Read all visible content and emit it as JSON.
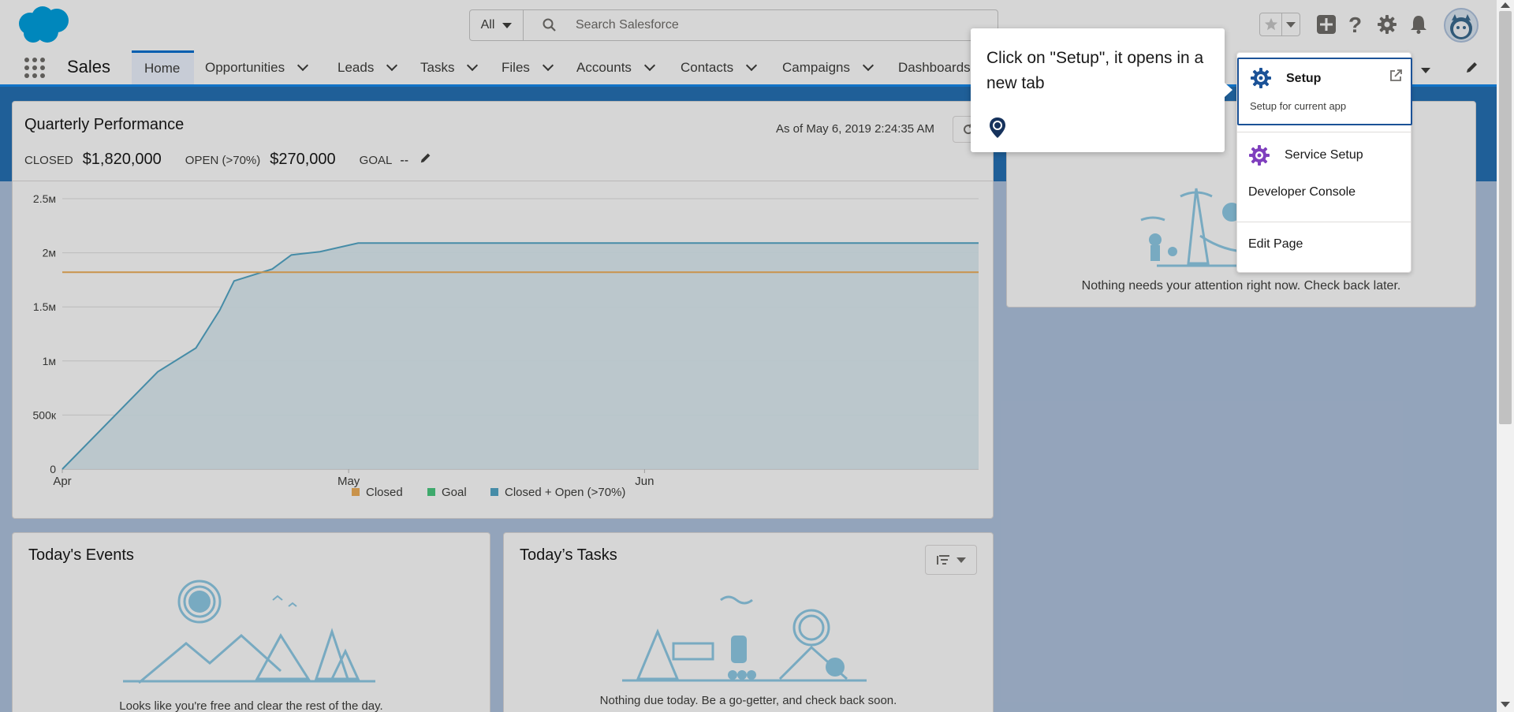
{
  "header": {
    "search_scope": "All",
    "search_placeholder": "Search Salesforce"
  },
  "nav": {
    "app_name": "Sales",
    "items": [
      {
        "label": "Home"
      },
      {
        "label": "Opportunities"
      },
      {
        "label": "Leads"
      },
      {
        "label": "Tasks"
      },
      {
        "label": "Files"
      },
      {
        "label": "Accounts"
      },
      {
        "label": "Contacts"
      },
      {
        "label": "Campaigns"
      },
      {
        "label": "Dashboards"
      }
    ]
  },
  "performance": {
    "title": "Quarterly Performance",
    "as_of": "As of May 6, 2019 2:24:35 AM",
    "closed_label": "CLOSED",
    "closed_value": "$1,820,000",
    "open_label": "OPEN (>70%)",
    "open_value": "$270,000",
    "goal_label": "GOAL",
    "goal_value": "--"
  },
  "chart_data": {
    "type": "line",
    "y_ticks": [
      "2.5м",
      "2м",
      "1.5м",
      "1м",
      "500к",
      "0"
    ],
    "x_ticks": [
      "Apr",
      "May",
      "Jun"
    ],
    "ylim": [
      0,
      2500000
    ],
    "grid": true,
    "legend_position": "bottom",
    "legend": [
      {
        "name": "Closed",
        "color": "#f0b05a"
      },
      {
        "name": "Goal",
        "color": "#4bca81"
      },
      {
        "name": "Closed + Open (>70%)",
        "color": "#54a7c7"
      }
    ],
    "series": [
      {
        "name": "Closed + Open (>70%)",
        "color": "#54a7c7",
        "x": [
          0,
          10,
          14,
          16.5,
          18,
          22,
          24,
          27,
          31,
          96
        ],
        "values": [
          0,
          900000,
          1120000,
          1470000,
          1740000,
          1850000,
          1980000,
          2010000,
          2090000,
          2090000
        ]
      },
      {
        "name": "Goal",
        "color": "#f0b05a",
        "x": [
          0,
          96
        ],
        "values": [
          1820000,
          1820000
        ]
      }
    ]
  },
  "events": {
    "title": "Today's Events",
    "empty_text": "Looks like you're free and clear the rest of the day."
  },
  "tasks": {
    "title": "Today’s Tasks",
    "empty_text": "Nothing due today. Be a go-getter, and check back soon."
  },
  "assistant": {
    "empty_text": "Nothing needs your attention right now. Check back later."
  },
  "tooltip": {
    "text": "Click on \"Setup\", it opens in a new tab"
  },
  "setup_menu": {
    "setup_label": "Setup",
    "setup_sub": "Setup for current app",
    "service_setup_label": "Service Setup",
    "developer_console_label": "Developer Console",
    "edit_page_label": "Edit Page"
  },
  "colors": {
    "brand_blue": "#00a1e0",
    "nav_accent": "#0070d2",
    "setup_icon": "#1b5297",
    "service_icon": "#7f3fbe"
  }
}
